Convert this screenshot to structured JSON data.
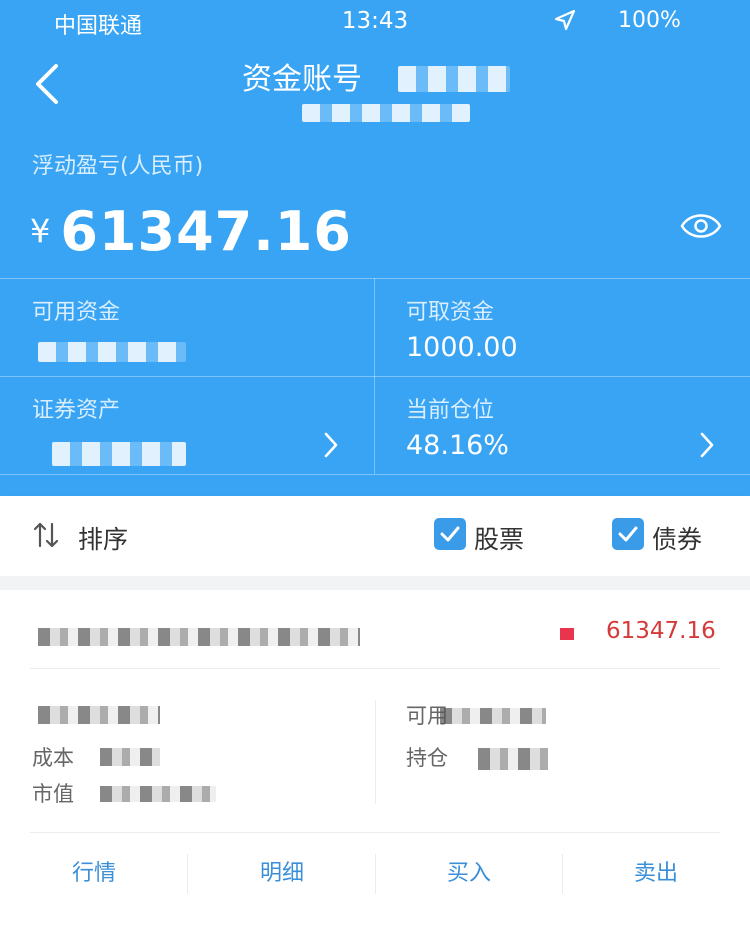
{
  "status_bar": {
    "carrier": "中国联通",
    "time": "13:43",
    "battery": "100%",
    "icons": [
      "location-arrow-icon"
    ]
  },
  "nav": {
    "title": "资金账号",
    "back_icon": "chevron-left-icon"
  },
  "summary": {
    "floating_pl_label": "浮动盈亏(人民币)",
    "currency_symbol": "¥",
    "floating_pl_value": "61347.16",
    "eye_icon": "eye-icon"
  },
  "funds": {
    "available_label": "可用资金",
    "withdrawable_label": "可取资金",
    "withdrawable_value": "1000.00",
    "securities_label": "证券资产",
    "position_label": "当前仓位",
    "position_value": "48.16%"
  },
  "filter_bar": {
    "sort_label": "排序",
    "stock_label": "股票",
    "stock_checked": true,
    "bond_label": "债券",
    "bond_checked": true
  },
  "holding": {
    "pl_value": "61347.16",
    "cost_label": "成本",
    "market_value_label": "市值",
    "available_label": "可用",
    "position_label": "持仓"
  },
  "actions": {
    "quote": "行情",
    "detail": "明细",
    "buy": "买入",
    "sell": "卖出"
  },
  "colors": {
    "header_blue": "#38a4f3",
    "accent_blue": "#3a8fd8",
    "loss_red": "#d43a3a"
  }
}
